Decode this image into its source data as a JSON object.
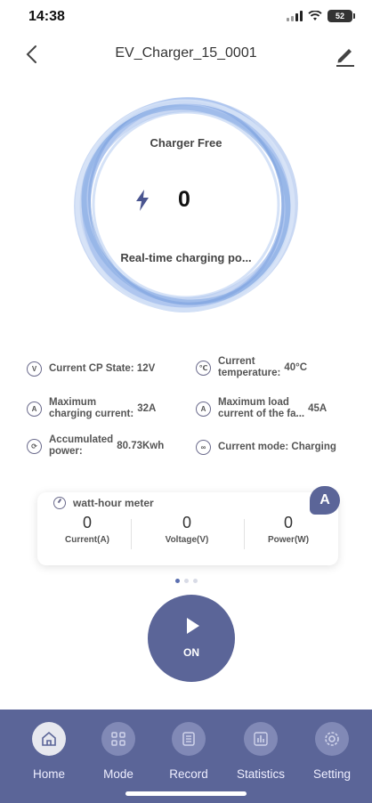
{
  "status_bar": {
    "time": "14:38",
    "battery": "52"
  },
  "header": {
    "title": "EV_Charger_15_0001",
    "back_icon": "chevron-left-icon",
    "edit_icon": "pencil-icon"
  },
  "ring": {
    "status": "Charger Free",
    "power_value": "0",
    "caption": "Real-time charging po...",
    "lightning_icon": "lightning-icon"
  },
  "info": [
    {
      "icon": "V",
      "icon_name": "cp-state-icon",
      "label_lines": [
        "Current CP State: 12V"
      ],
      "value": ""
    },
    {
      "icon": "℃",
      "icon_name": "thermometer-icon",
      "label_lines": [
        "Current",
        "temperature:"
      ],
      "value": "40°C"
    },
    {
      "icon": "A",
      "icon_name": "max-current-icon",
      "label_lines": [
        "Maximum",
        "charging current:"
      ],
      "value": "32A"
    },
    {
      "icon": "A",
      "icon_name": "max-load-icon",
      "label_lines": [
        "Maximum load",
        "current of the fa..."
      ],
      "value": "45A"
    },
    {
      "icon": "⟳",
      "icon_name": "accumulated-power-icon",
      "label_lines": [
        "Accumulated",
        "power:"
      ],
      "value": "80.73Kwh"
    },
    {
      "icon": "∞",
      "icon_name": "mode-icon",
      "label_lines": [
        "Current mode: Charging"
      ],
      "value": ""
    }
  ],
  "meter": {
    "title": "watt-hour meter",
    "badge": "A",
    "columns": [
      {
        "value": "0",
        "label": "Current(A)"
      },
      {
        "value": "0",
        "label": "Voltage(V)"
      },
      {
        "value": "0",
        "label": "Power(W)"
      }
    ]
  },
  "pager": {
    "count": 3,
    "active": 0
  },
  "action": {
    "label": "ON",
    "icon": "play-icon"
  },
  "tabs": [
    {
      "label": "Home",
      "icon": "home-icon",
      "active": true
    },
    {
      "label": "Mode",
      "icon": "grid-icon",
      "active": false
    },
    {
      "label": "Record",
      "icon": "record-icon",
      "active": false
    },
    {
      "label": "Statistics",
      "icon": "bar-chart-icon",
      "active": false
    },
    {
      "label": "Setting",
      "icon": "gear-icon",
      "active": false
    }
  ],
  "colors": {
    "primary": "#5b6598",
    "ring": "#8fb1e6",
    "text": "#555555"
  }
}
